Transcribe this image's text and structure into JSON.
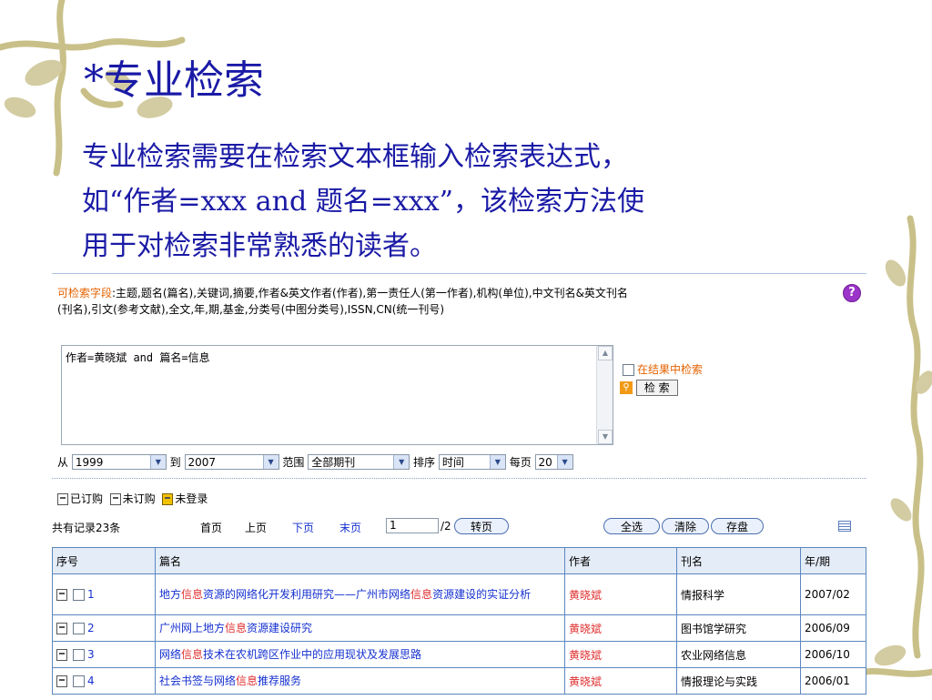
{
  "slide": {
    "title": "*专业检索",
    "body_lines": [
      "专业检索需要在检索文本框输入检索表达式，",
      "如“作者=xxx and 题名=xxx”，该检索方法使",
      "用于对检索非常熟悉的读者。"
    ]
  },
  "form": {
    "fields_label": "可检索字段",
    "fields_text": ":主题,题名(篇名),关键词,摘要,作者&英文作者(作者),第一责任人(第一作者),机构(单位),中文刊名&英文刊名(刊名),引文(参考文献),全文,年,期,基金,分类号(中图分类号),ISSN,CN(统一刊号)",
    "help_icon": "?",
    "query": "作者=黄晓斌 and 篇名=信息",
    "in_result_label": "在结果中检索",
    "search_button": "检 索",
    "from_label": "从",
    "from_year": "1999",
    "to_label": "到",
    "to_year": "2007",
    "range_label": "范围",
    "range_value": "全部期刊",
    "sort_label": "排序",
    "sort_value": "时间",
    "per_page_label": "每页",
    "per_page_value": "20"
  },
  "legend": {
    "subscribed": "已订购",
    "unsubscribed": "未订购",
    "not_logged_in": "未登录"
  },
  "pager": {
    "total": "共有记录23条",
    "first": "首页",
    "prev": "上页",
    "next": "下页",
    "last": "末页",
    "page_value": "1",
    "page_total": "/2",
    "go": "转页",
    "select_all": "全选",
    "clear": "清除",
    "save": "存盘"
  },
  "table": {
    "headers": {
      "seq": "序号",
      "title": "篇名",
      "author": "作者",
      "journal": "刊名",
      "year": "年/期"
    },
    "rows": [
      {
        "seq": "1",
        "title_parts": [
          "地方",
          "信息",
          "资源的网络化开发利用研究——广州市网络",
          "信息",
          "资源建设的实证分析"
        ],
        "author": "黄晓斌",
        "journal": "情报科学",
        "year": "2007/02"
      },
      {
        "seq": "2",
        "title_parts": [
          "广州网上地方",
          "信息",
          "资源建设研究"
        ],
        "author": "黄晓斌",
        "journal": "图书馆学研究",
        "year": "2006/09"
      },
      {
        "seq": "3",
        "title_parts": [
          "网络",
          "信息",
          "技术在农机跨区作业中的应用现状及发展思路"
        ],
        "author": "黄晓斌",
        "journal": "农业网络信息",
        "year": "2006/10"
      },
      {
        "seq": "4",
        "title_parts": [
          "社会书签与网络",
          "信息",
          "推荐服务"
        ],
        "author": "黄晓斌",
        "journal": "情报理论与实践",
        "year": "2006/01"
      }
    ]
  },
  "colors": {
    "slide_text": "#1a1aa6",
    "field_label": "#e56200",
    "link": "#1530d0",
    "highlight": "#e03030",
    "table_border": "#5b87c0",
    "vine": "#c9c089"
  }
}
